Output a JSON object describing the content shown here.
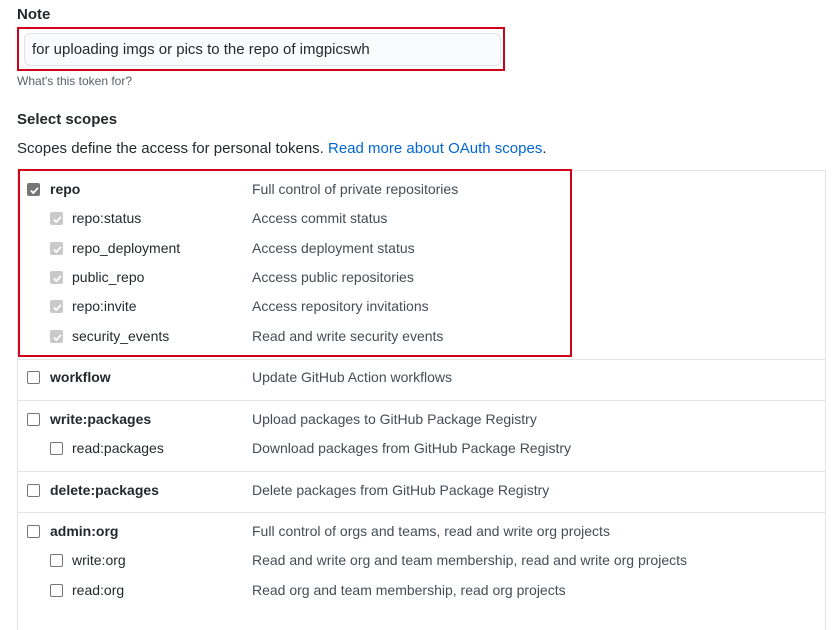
{
  "note": {
    "label": "Note",
    "value": "for uploading imgs or pics to the repo of imgpicswh",
    "help": "What's this token for?"
  },
  "scopes": {
    "title": "Select scopes",
    "description": "Scopes define the access for personal tokens.",
    "link": "Read more about OAuth scopes",
    "link_suffix": "."
  },
  "rows": [
    {
      "name": "repo",
      "desc": "Full control of private repositories",
      "checked": true,
      "child": false
    },
    {
      "name": "repo:status",
      "desc": "Access commit status",
      "checked": true,
      "child": true
    },
    {
      "name": "repo_deployment",
      "desc": "Access deployment status",
      "checked": true,
      "child": true
    },
    {
      "name": "public_repo",
      "desc": "Access public repositories",
      "checked": true,
      "child": true
    },
    {
      "name": "repo:invite",
      "desc": "Access repository invitations",
      "checked": true,
      "child": true
    },
    {
      "name": "security_events",
      "desc": "Read and write security events",
      "checked": true,
      "child": true
    },
    {
      "name": "workflow",
      "desc": "Update GitHub Action workflows",
      "checked": false,
      "child": false
    },
    {
      "name": "write:packages",
      "desc": "Upload packages to GitHub Package Registry",
      "checked": false,
      "child": false
    },
    {
      "name": "read:packages",
      "desc": "Download packages from GitHub Package Registry",
      "checked": false,
      "child": true
    },
    {
      "name": "delete:packages",
      "desc": "Delete packages from GitHub Package Registry",
      "checked": false,
      "child": false
    },
    {
      "name": "admin:org",
      "desc": "Full control of orgs and teams, read and write org projects",
      "checked": false,
      "child": false
    },
    {
      "name": "write:org",
      "desc": "Read and write org and team membership, read and write org projects",
      "checked": false,
      "child": true
    },
    {
      "name": "read:org",
      "desc": "Read org and team membership, read org projects",
      "checked": false,
      "child": true
    }
  ]
}
